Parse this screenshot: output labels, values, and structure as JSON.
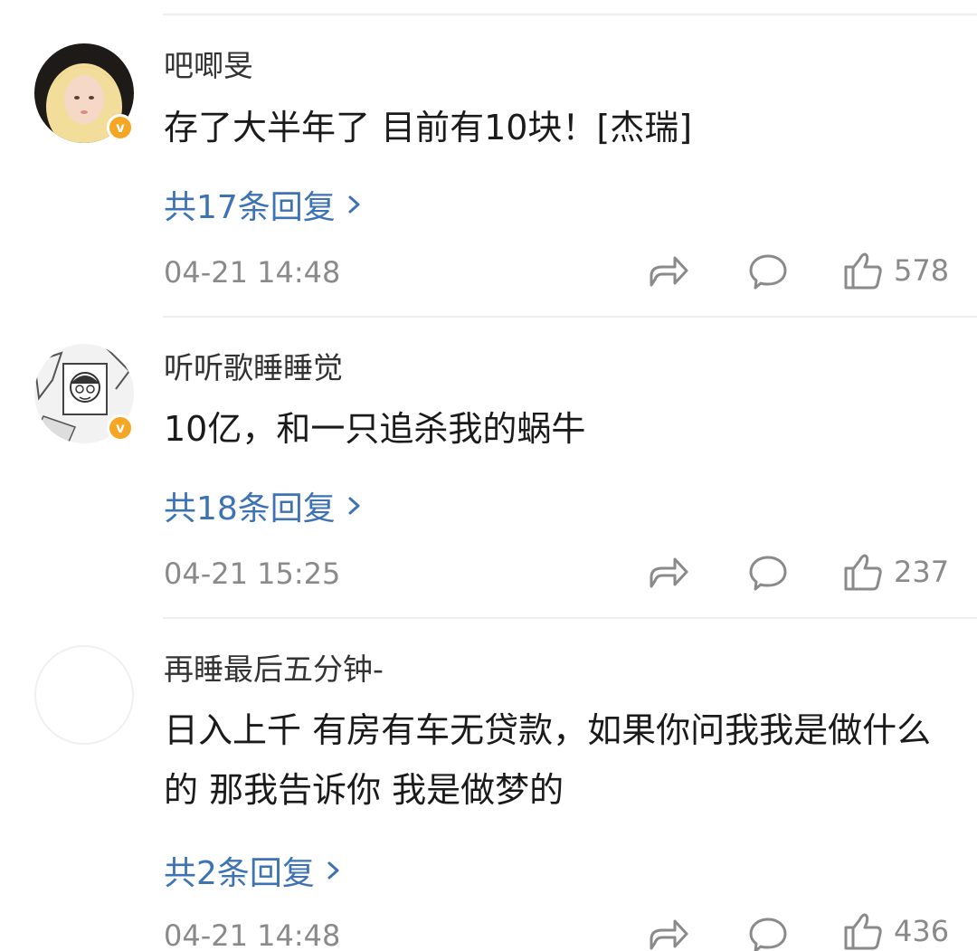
{
  "comments": [
    {
      "username": "吧唧旻",
      "content": "存了大半年了 目前有10块！[杰瑞]",
      "replies": "共17条回复",
      "time": "04-21 14:48",
      "likes": "578",
      "verified": true
    },
    {
      "username": "听听歌睡睡觉",
      "content": "10亿，和一只追杀我的蜗牛",
      "replies": "共18条回复",
      "time": "04-21 15:25",
      "likes": "237",
      "verified": true
    },
    {
      "username": "再睡最后五分钟-",
      "content": "日入上千 有房有车无贷款，如果你问我我是做什么的 那我告诉你 我是做梦的",
      "replies": "共2条回复",
      "time": "04-21 14:48",
      "likes": "436",
      "verified": false
    }
  ],
  "colors": {
    "link": "#3d73b5",
    "meta": "#8a8a8a",
    "badge": "#f5a623"
  },
  "icons": [
    "share-icon",
    "comment-icon",
    "like-icon",
    "chevron-right-icon",
    "verified-badge-icon"
  ]
}
